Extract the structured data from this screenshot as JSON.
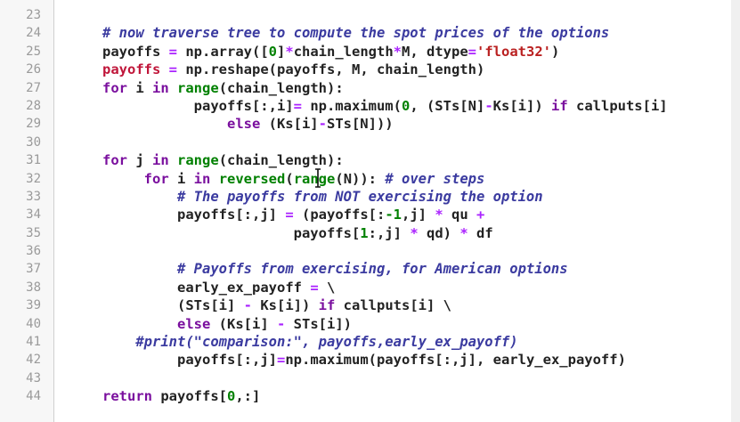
{
  "editor": {
    "cursor_icon": "i-beam-cursor-icon",
    "lines": [
      {
        "num": "23",
        "indent": "",
        "tokens": []
      },
      {
        "num": "24",
        "indent": "",
        "tokens": [
          {
            "t": "# now traverse tree to compute the spot prices of the options",
            "c": "cm"
          }
        ]
      },
      {
        "num": "25",
        "indent": "",
        "tokens": [
          {
            "t": "payoffs ",
            "c": ""
          },
          {
            "t": "=",
            "c": "op"
          },
          {
            "t": " np.array([",
            "c": ""
          },
          {
            "t": "0",
            "c": "num"
          },
          {
            "t": "]",
            "c": ""
          },
          {
            "t": "*",
            "c": "op"
          },
          {
            "t": "chain_length",
            "c": ""
          },
          {
            "t": "*",
            "c": "op"
          },
          {
            "t": "M, dtype",
            "c": ""
          },
          {
            "t": "=",
            "c": "op"
          },
          {
            "t": "'float32'",
            "c": "str"
          },
          {
            "t": ")",
            "c": ""
          }
        ]
      },
      {
        "num": "26",
        "indent": "",
        "tokens": [
          {
            "t": "payoffs",
            "c": "rv"
          },
          {
            "t": " ",
            "c": ""
          },
          {
            "t": "=",
            "c": "op"
          },
          {
            "t": " np.reshape(payoffs, M, chain_length)",
            "c": ""
          }
        ]
      },
      {
        "num": "27",
        "indent": "",
        "tokens": [
          {
            "t": "for",
            "c": "kw"
          },
          {
            "t": " i ",
            "c": ""
          },
          {
            "t": "in",
            "c": "kw"
          },
          {
            "t": " ",
            "c": ""
          },
          {
            "t": "range",
            "c": "bi"
          },
          {
            "t": "(chain_length):",
            "c": ""
          }
        ]
      },
      {
        "num": "28",
        "indent": "           ",
        "tokens": [
          {
            "t": "payoffs[:,i]",
            "c": ""
          },
          {
            "t": "=",
            "c": "op"
          },
          {
            "t": " np.maximum(",
            "c": ""
          },
          {
            "t": "0",
            "c": "num"
          },
          {
            "t": ", (STs[N]",
            "c": ""
          },
          {
            "t": "-",
            "c": "op"
          },
          {
            "t": "Ks[i]) ",
            "c": ""
          },
          {
            "t": "if",
            "c": "kw"
          },
          {
            "t": " callputs[i]",
            "c": ""
          }
        ]
      },
      {
        "num": "29",
        "indent": "               ",
        "tokens": [
          {
            "t": "else",
            "c": "kw"
          },
          {
            "t": " (Ks[i]",
            "c": ""
          },
          {
            "t": "-",
            "c": "op"
          },
          {
            "t": "STs[N]))",
            "c": ""
          }
        ]
      },
      {
        "num": "30",
        "indent": "",
        "tokens": []
      },
      {
        "num": "31",
        "indent": "",
        "tokens": [
          {
            "t": "for",
            "c": "kw"
          },
          {
            "t": " j ",
            "c": ""
          },
          {
            "t": "in",
            "c": "kw"
          },
          {
            "t": " ",
            "c": ""
          },
          {
            "t": "range",
            "c": "bi"
          },
          {
            "t": "(chain_length):",
            "c": ""
          }
        ]
      },
      {
        "num": "32",
        "indent": "     ",
        "tokens": [
          {
            "t": "for",
            "c": "kw"
          },
          {
            "t": " i ",
            "c": ""
          },
          {
            "t": "in",
            "c": "kw"
          },
          {
            "t": " ",
            "c": ""
          },
          {
            "t": "reversed",
            "c": "bi"
          },
          {
            "t": "(",
            "c": ""
          },
          {
            "t": "range",
            "c": "bi"
          },
          {
            "t": "(N)): ",
            "c": ""
          },
          {
            "t": "# over steps",
            "c": "cm"
          }
        ]
      },
      {
        "num": "33",
        "indent": "         ",
        "tokens": [
          {
            "t": "# The payoffs from NOT exercising the option",
            "c": "cm"
          }
        ]
      },
      {
        "num": "34",
        "indent": "         ",
        "tokens": [
          {
            "t": "payoffs[:,j] ",
            "c": ""
          },
          {
            "t": "=",
            "c": "op"
          },
          {
            "t": " (payoffs[:",
            "c": ""
          },
          {
            "t": "-1",
            "c": "num"
          },
          {
            "t": ",j] ",
            "c": ""
          },
          {
            "t": "*",
            "c": "op"
          },
          {
            "t": " qu ",
            "c": ""
          },
          {
            "t": "+",
            "c": "op"
          }
        ]
      },
      {
        "num": "35",
        "indent": "                       ",
        "tokens": [
          {
            "t": "payoffs[",
            "c": ""
          },
          {
            "t": "1",
            "c": "num"
          },
          {
            "t": ":,j] ",
            "c": ""
          },
          {
            "t": "*",
            "c": "op"
          },
          {
            "t": " qd) ",
            "c": ""
          },
          {
            "t": "*",
            "c": "op"
          },
          {
            "t": " df",
            "c": ""
          }
        ]
      },
      {
        "num": "36",
        "indent": "",
        "tokens": []
      },
      {
        "num": "37",
        "indent": "         ",
        "tokens": [
          {
            "t": "# Payoffs from exercising, for American options",
            "c": "cm"
          }
        ]
      },
      {
        "num": "38",
        "indent": "         ",
        "tokens": [
          {
            "t": "early_ex_payoff ",
            "c": ""
          },
          {
            "t": "=",
            "c": "op"
          },
          {
            "t": " \\",
            "c": ""
          }
        ]
      },
      {
        "num": "39",
        "indent": "         ",
        "tokens": [
          {
            "t": "(STs[i] ",
            "c": ""
          },
          {
            "t": "-",
            "c": "op"
          },
          {
            "t": " Ks[i]) ",
            "c": ""
          },
          {
            "t": "if",
            "c": "kw"
          },
          {
            "t": " callputs[i] \\",
            "c": ""
          }
        ]
      },
      {
        "num": "40",
        "indent": "         ",
        "tokens": [
          {
            "t": "else",
            "c": "kw"
          },
          {
            "t": " (Ks[i] ",
            "c": ""
          },
          {
            "t": "-",
            "c": "op"
          },
          {
            "t": " STs[i])",
            "c": ""
          }
        ]
      },
      {
        "num": "41",
        "indent": "    ",
        "tokens": [
          {
            "t": "#print(\"comparison:\", payoffs,early_ex_payoff)",
            "c": "cm"
          }
        ]
      },
      {
        "num": "42",
        "indent": "         ",
        "tokens": [
          {
            "t": "payoffs[:,j]",
            "c": ""
          },
          {
            "t": "=",
            "c": "op"
          },
          {
            "t": "np.maximum(payoffs[:,j], early_ex_payoff)",
            "c": ""
          }
        ]
      },
      {
        "num": "43",
        "indent": "",
        "tokens": []
      },
      {
        "num": "44",
        "indent": "",
        "tokens": [
          {
            "t": "return",
            "c": "kw"
          },
          {
            "t": " payoffs[",
            "c": ""
          },
          {
            "t": "0",
            "c": "num"
          },
          {
            "t": ",:]",
            "c": ""
          }
        ]
      }
    ]
  }
}
